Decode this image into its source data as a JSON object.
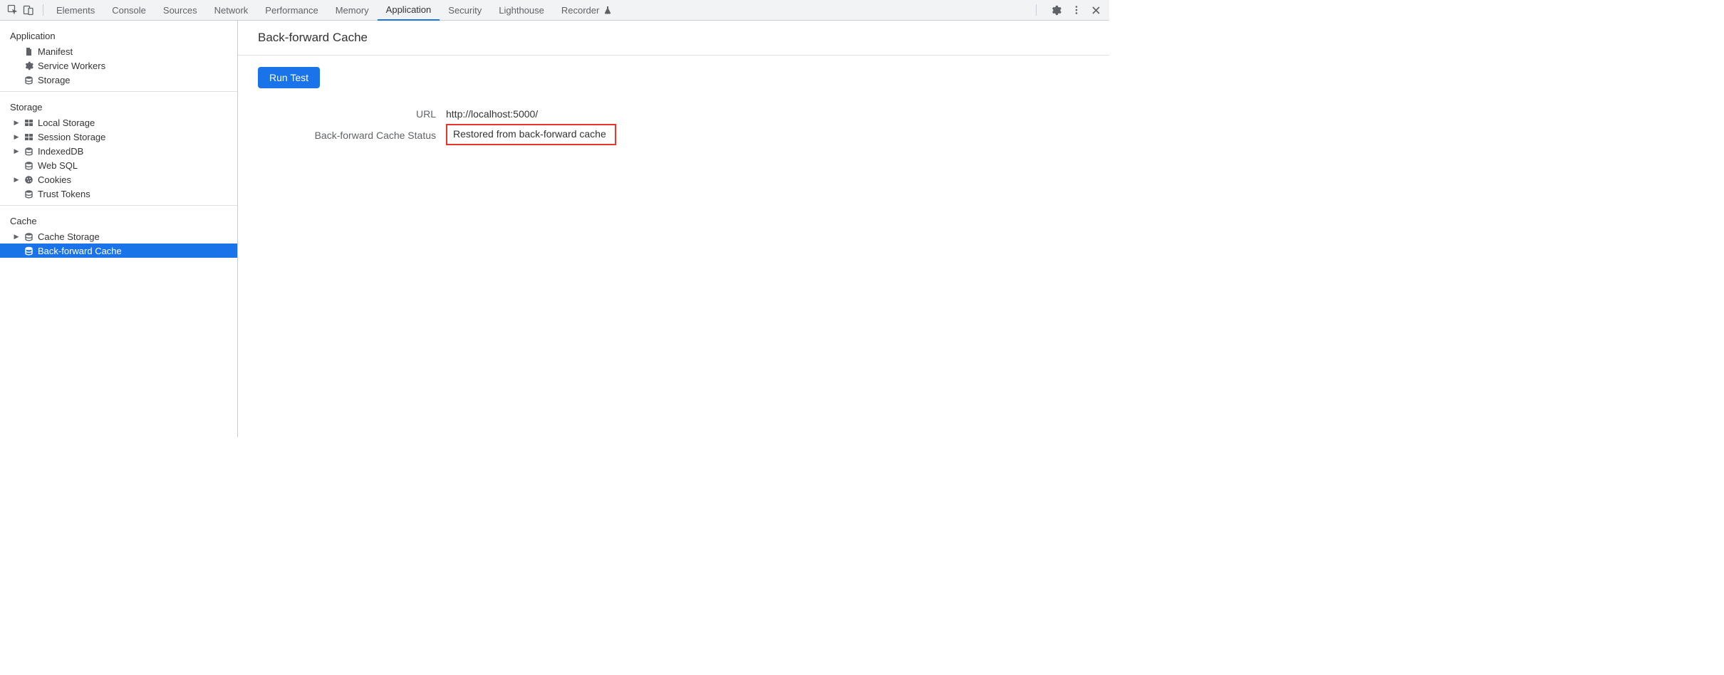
{
  "tabs": [
    "Elements",
    "Console",
    "Sources",
    "Network",
    "Performance",
    "Memory",
    "Application",
    "Security",
    "Lighthouse",
    "Recorder"
  ],
  "activeTab": "Application",
  "sidebar": {
    "sections": [
      {
        "title": "Application",
        "items": [
          {
            "label": "Manifest",
            "icon": "document",
            "expandable": false
          },
          {
            "label": "Service Workers",
            "icon": "gear",
            "expandable": false
          },
          {
            "label": "Storage",
            "icon": "db",
            "expandable": false
          }
        ]
      },
      {
        "title": "Storage",
        "items": [
          {
            "label": "Local Storage",
            "icon": "grid",
            "expandable": true
          },
          {
            "label": "Session Storage",
            "icon": "grid",
            "expandable": true
          },
          {
            "label": "IndexedDB",
            "icon": "db",
            "expandable": true
          },
          {
            "label": "Web SQL",
            "icon": "db",
            "expandable": false
          },
          {
            "label": "Cookies",
            "icon": "cookie",
            "expandable": true
          },
          {
            "label": "Trust Tokens",
            "icon": "db",
            "expandable": false
          }
        ]
      },
      {
        "title": "Cache",
        "items": [
          {
            "label": "Cache Storage",
            "icon": "db",
            "expandable": true
          },
          {
            "label": "Back-forward Cache",
            "icon": "db",
            "expandable": false,
            "selected": true
          }
        ]
      }
    ]
  },
  "content": {
    "title": "Back-forward Cache",
    "run_label": "Run Test",
    "url_label": "URL",
    "url_value": "http://localhost:5000/",
    "status_label": "Back-forward Cache Status",
    "status_value": "Restored from back-forward cache"
  }
}
